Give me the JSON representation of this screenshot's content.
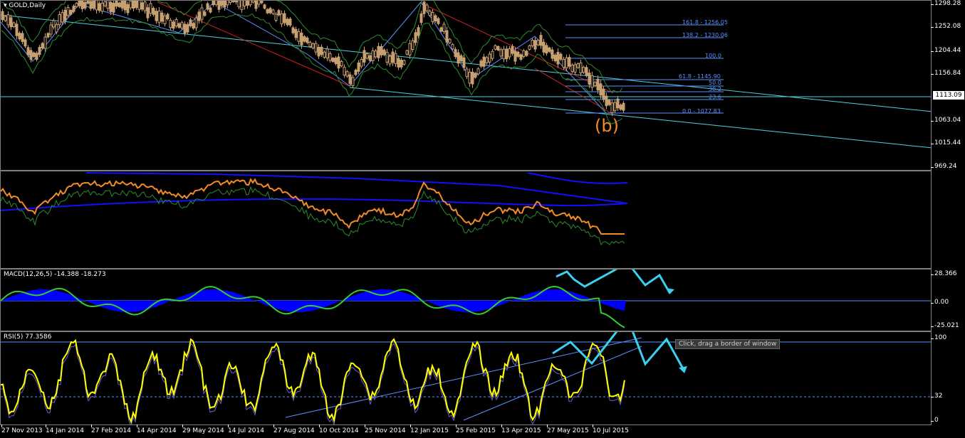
{
  "main_pane": {
    "label": "GOLD,Daily",
    "price_ticks": [
      "1298.28",
      "1252.08",
      "1204.44",
      "1156.84",
      "1113.09",
      "1063.04",
      "1015.44",
      "969.24"
    ],
    "current_price": "1113.09",
    "wave_label": "(b)",
    "fib_levels": [
      {
        "label": "161.8 - 1256.05"
      },
      {
        "label": "138.2 - 1230.06"
      },
      {
        "label": "100.0"
      },
      {
        "label": "61.8 - 1145.90"
      },
      {
        "label": "50.0"
      },
      {
        "label": "38.2"
      },
      {
        "label": "23.6"
      },
      {
        "label": "0.0 - 1077.83"
      }
    ]
  },
  "macd_pane": {
    "label": "MACD(12,26,5) -14.388 -18.273",
    "ticks": [
      "28.366",
      "0.00",
      "-25.021"
    ]
  },
  "rsi_pane": {
    "label": "RSI(5) 77.3586",
    "ticks": [
      "100",
      "32",
      "0"
    ]
  },
  "time_axis": [
    "27 Nov 2013",
    "14 Jan 2014",
    "27 Feb 2014",
    "14 Apr 2014",
    "29 May 2014",
    "14 Jul 2014",
    "27 Aug 2014",
    "10 Oct 2014",
    "25 Nov 2014",
    "12 Jan 2015",
    "25 Feb 2015",
    "13 Apr 2015",
    "27 May 2015",
    "10 Jul 2015"
  ],
  "tooltip": "Click, drag a border of window",
  "colors": {
    "candle": "#c8a070",
    "bull_body": "#000000",
    "fib": "#5b8fff",
    "trend": "#4fd0e0",
    "channel": "#d02020",
    "envelope": "#2e8b2e",
    "orange": "#f28c28",
    "macd_hist": "#0000ff",
    "macd_line": "#33cc33",
    "rsi": "#ffff00",
    "projection": "#3ad0f0"
  }
}
